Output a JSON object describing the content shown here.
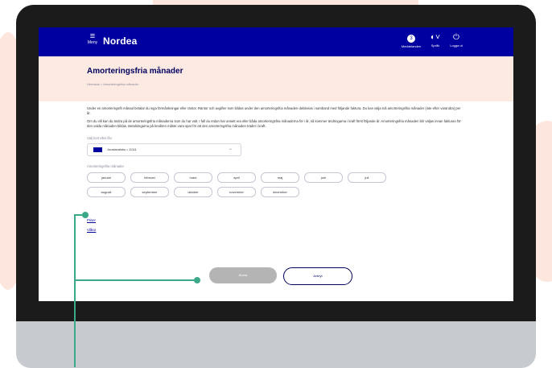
{
  "nav": {
    "menu_label": "Meny",
    "brand": "Nordea",
    "items": [
      {
        "label": "Meddelanden",
        "badge": "3"
      },
      {
        "label": "Språk"
      },
      {
        "label": "Logga ut"
      }
    ]
  },
  "page": {
    "title": "Amorteringsfria månader",
    "breadcrumb": "Hemsida > Amorteringsfria månader",
    "paragraph1": "Under en amorteringsfri månad betalar du inga förmånkningar eller räntor. Räntor och avgifter som bildas under den amorteringsfria månaden debiteras i samband med följande faktura. Du kan välja två amorteringsfria månader (inte efter varandra) per år.",
    "paragraph2": "Om du vill kan du ändra på de amorteringsfria månaderna som du har valt. I fall du redan har ansett era eller båda amorteringsfria månaderna för i år, så kommer ändringarna i kraft först följande år. Amorteringsfria månaden blir väljas innan fakturan för den valda månaden bildas. Betalningarna på krediten måste vara spar för att den amorteringsfria månaden träder i kraft."
  },
  "form": {
    "card_label": "Välj kort eller lån",
    "card_value": "Joustavaluku • 11111",
    "months_label": "Amorteringsfria månader",
    "months": [
      "januari",
      "februari",
      "mars",
      "april",
      "maj",
      "juni",
      "juli",
      "augusti",
      "september",
      "oktober",
      "november",
      "december"
    ]
  },
  "links": [
    "Priser",
    "Villkor"
  ],
  "buttons": {
    "primary": "Ändra",
    "secondary": "Avbryt"
  },
  "colors": {
    "brand_blue": "#0000a0",
    "header_bg": "#fdeae3",
    "callout": "#3aa889"
  }
}
